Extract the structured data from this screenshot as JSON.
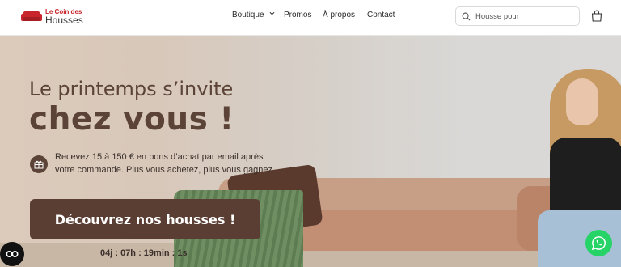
{
  "brand": {
    "line1": "Le Coin des",
    "line2": "Housses",
    "accent_color": "#c8242b"
  },
  "nav": {
    "items": [
      {
        "label": "Boutique",
        "has_dropdown": true
      },
      {
        "label": "Promos"
      },
      {
        "label": "À propos"
      },
      {
        "label": "Contact"
      }
    ]
  },
  "search": {
    "placeholder": "Housse pour",
    "value": "",
    "icon": "search-icon"
  },
  "cart": {
    "icon": "shopping-bag-icon"
  },
  "hero": {
    "title_line1": "Le printemps s’invite",
    "title_line2": "chez vous !",
    "promo_line1": "Recevez 15 à 150 € en bons d’achat par email après",
    "promo_line2": "votre commande. Plus vous achetez, plus vous gagnez",
    "promo_icon": "gift-icon",
    "cta_label": "Découvrez nos housses !",
    "countdown": "04j : 07h : 19min : 1s",
    "text_color": "#5c4338",
    "cta_color": "#5b3e33"
  },
  "floating": {
    "accessibility_icon": "accessibility-icon",
    "whatsapp_icon": "whatsapp-icon",
    "whatsapp_color": "#25d366"
  }
}
